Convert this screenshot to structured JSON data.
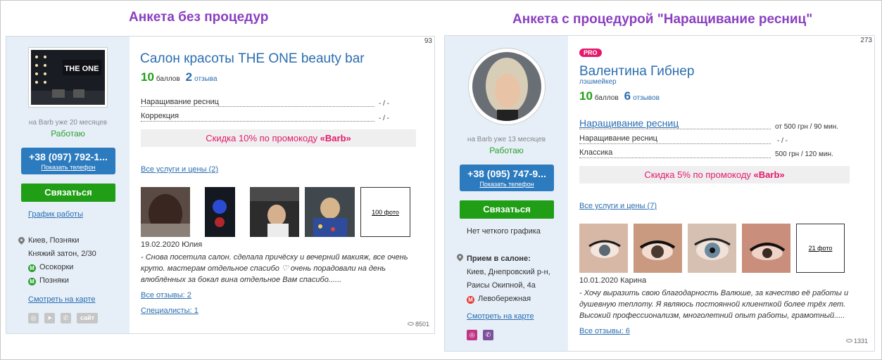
{
  "headings": {
    "left": "Анкета без процедур",
    "right": "Анкета с процедурой \"Наращивание ресниц\""
  },
  "left": {
    "counter": "93",
    "on_barb": "на Barb уже 20 месяцев",
    "status": "Работаю",
    "phone": "+38 (097) 792-1...",
    "show_phone": "Показать телефон",
    "contact": "Связаться",
    "schedule": "График работы",
    "city": "Киев, Позняки",
    "street": "Княжий затон, 2/30",
    "metro": [
      {
        "letter": "М",
        "name": "Осокорки",
        "color": "#2c9e2c"
      },
      {
        "letter": "М",
        "name": "Позняки",
        "color": "#2c9e2c"
      }
    ],
    "map_link": "Смотреть на карте",
    "social_site": "сайт",
    "title": "Салон красоты THE ONE beauty bar",
    "points": "10",
    "points_label": "баллов",
    "reviews_count": "2",
    "reviews_label": "отзыва",
    "services": [
      {
        "name": "Наращивание ресниц",
        "value": "- / -"
      },
      {
        "name": "Коррекция",
        "value": "- / -"
      }
    ],
    "promo_text": "Скидка 10% по промокоду ",
    "promo_code": "«Barb»",
    "all_services": "Все услуги и цены (2)",
    "photos_more": "100 фото",
    "review_date": "19.02.2020 Юлия",
    "review_text": "- Снова посетила салон. сделала причёску и вечерний макияж, все очень круто. мастерам отдельное спасибо ♡ очень порадовали на день влюблённых за бокал вина отдельное Вам спасибо......",
    "all_reviews": "Все отзывы: 2",
    "specialists": "Специалисты: 1",
    "views": "8501",
    "logo_text": "THE ONE"
  },
  "right": {
    "counter": "273",
    "on_barb": "на Barb уже 13 месяцев",
    "status": "Работаю",
    "phone": "+38 (095) 747-9...",
    "show_phone": "Показать телефон",
    "contact": "Связаться",
    "schedule": "Нет четкого графика",
    "reception": "Прием в салоне:",
    "city": "Киев, Днепровский р-н,",
    "street": "Раисы Окипной, 4а",
    "metro": [
      {
        "letter": "М",
        "name": "Левобережная",
        "color": "#e53935"
      }
    ],
    "map_link": "Смотреть на карте",
    "pro": "PRO",
    "title": "Валентина Гибнер",
    "subtitle": "лэшмейкер",
    "points": "10",
    "points_label": "баллов",
    "reviews_count": "6",
    "reviews_label": "отзывов",
    "services": [
      {
        "name": "Наращивание ресниц",
        "value": "от 500 грн  / 90 мин."
      },
      {
        "name": "Наращивание ресниц",
        "value": "- / -"
      },
      {
        "name": "Классика",
        "value": "500 грн  / 120 мин."
      }
    ],
    "promo_text": "Скидка 5% по промокоду ",
    "promo_code": "«Barb»",
    "all_services": "Все услуги и цены (7)",
    "photos_more": "21 фото",
    "review_date": "10.01.2020 Карина",
    "review_text": "- Хочу выразить свою благодарность Валюше, за качество её работы и душевную теплоту. Я являюсь постоянной клиенткой более трёх лет. Высокий профессионализм, многолетний опыт работы, грамотный.....",
    "all_reviews": "Все отзывы: 6",
    "views": "1331"
  }
}
